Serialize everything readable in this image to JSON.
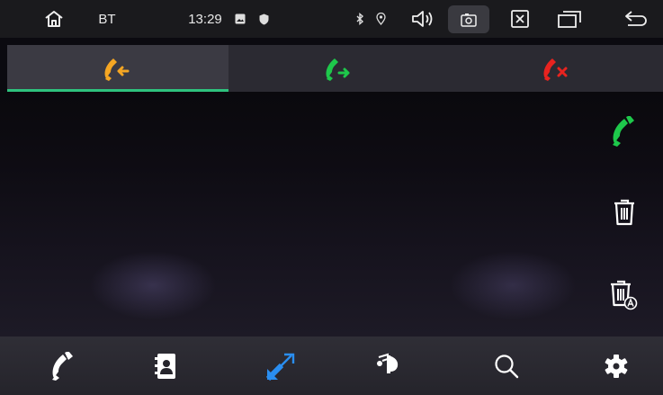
{
  "status_bar": {
    "app_label": "BT",
    "time": "13:29",
    "icons": {
      "home": "home-icon",
      "notification_image": "image-icon",
      "notification_shield": "shield-icon",
      "bluetooth": "bluetooth-icon",
      "location": "location-icon",
      "volume": "volume-icon",
      "screenshot": "screenshot-icon",
      "close": "close-icon",
      "recent_apps": "recent-apps-icon",
      "back": "back-icon"
    }
  },
  "call_log_tabs": {
    "selected": "incoming",
    "tabs": [
      {
        "id": "incoming",
        "icon": "incoming-call-icon",
        "color": "#f5a623"
      },
      {
        "id": "outgoing",
        "icon": "outgoing-call-icon",
        "color": "#1ec84b"
      },
      {
        "id": "missed",
        "icon": "missed-call-icon",
        "color": "#e8231f"
      }
    ],
    "indicator_color": "#2ec27e"
  },
  "side_actions": [
    {
      "id": "dial",
      "icon": "dial-call-icon",
      "color": "#1ec84b"
    },
    {
      "id": "delete",
      "icon": "trash-icon",
      "color": "#ffffff"
    },
    {
      "id": "delete_all",
      "icon": "trash-all-icon",
      "color": "#ffffff"
    }
  ],
  "bottom_nav": {
    "selected": "call_log",
    "items": [
      {
        "id": "dialpad",
        "icon": "phone-icon"
      },
      {
        "id": "contacts",
        "icon": "contacts-icon"
      },
      {
        "id": "call_log",
        "icon": "call-log-icon",
        "color": "#2a8ef0"
      },
      {
        "id": "music",
        "icon": "music-icon"
      },
      {
        "id": "search",
        "icon": "search-icon"
      },
      {
        "id": "settings",
        "icon": "gear-icon"
      }
    ]
  }
}
